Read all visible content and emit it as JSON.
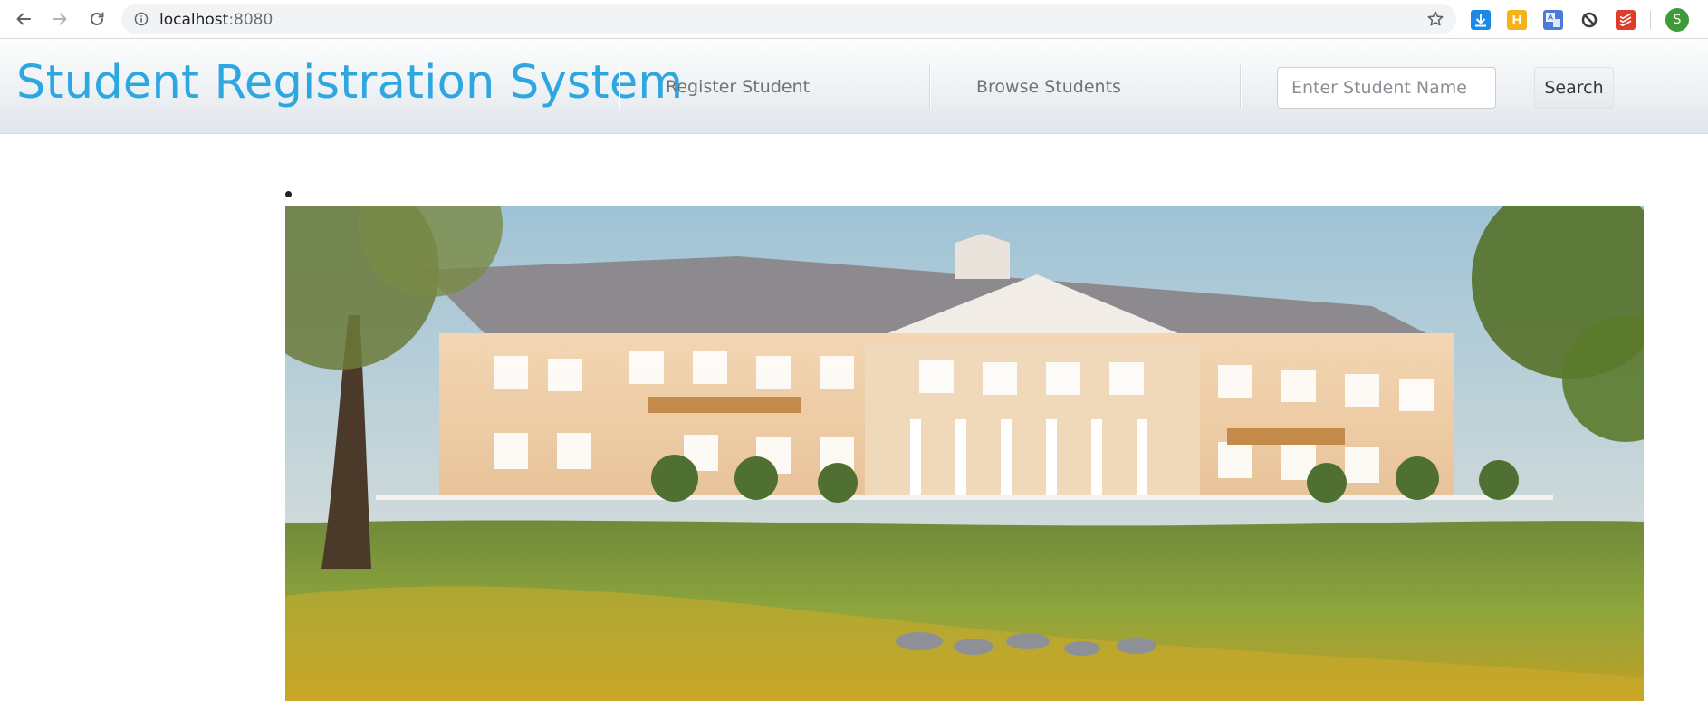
{
  "browser": {
    "url_host": "localhost",
    "url_port": ":8080",
    "profile_initial": "S",
    "extensions": [
      {
        "icon": "download-extension-icon",
        "color": "#1e88e5"
      },
      {
        "icon": "honey-extension-icon",
        "label": "H",
        "color": "#f5b31b"
      },
      {
        "icon": "google-translate-icon",
        "color": "#4a7bd9"
      },
      {
        "icon": "sync-extension-icon",
        "color": "#3c3c3c"
      },
      {
        "icon": "todoist-icon",
        "color": "#e03c2a"
      }
    ]
  },
  "navbar": {
    "brand": "Student Registration System",
    "links": [
      "Register Student",
      "Browse Students"
    ],
    "search": {
      "placeholder": "Enter Student Name",
      "value": "",
      "button_label": "Search"
    },
    "colors": {
      "brand": "#2ea7e0",
      "link": "#6f7479"
    }
  },
  "content": {
    "image": "campus-building-photo"
  }
}
